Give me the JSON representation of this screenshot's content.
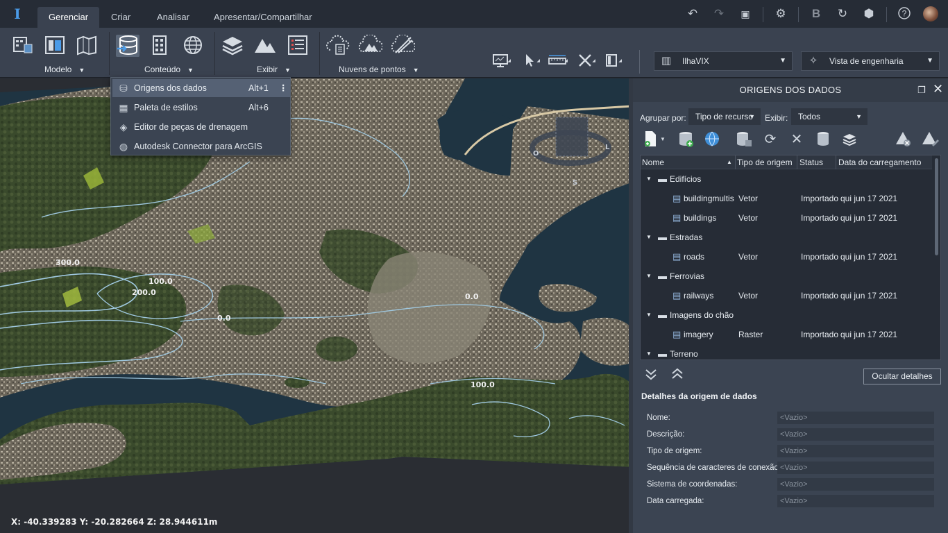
{
  "tabs": [
    {
      "label": "Gerenciar",
      "active": true
    },
    {
      "label": "Criar"
    },
    {
      "label": "Analisar"
    },
    {
      "label": "Apresentar/Compartilhar"
    }
  ],
  "top_icons": [
    "undo-icon",
    "redo-icon",
    "screen-icon",
    "gear-icon",
    "b-icon",
    "sync-icon",
    "cube-icon",
    "help-icon",
    "avatar"
  ],
  "ribbon": {
    "groups": [
      {
        "label": "Modelo"
      },
      {
        "label": "Conteúdo"
      },
      {
        "label": "Exibir"
      },
      {
        "label": "Nuvens de pontos"
      }
    ],
    "model_combo": "IlhaVIX",
    "view_combo": "Vista de engenharia"
  },
  "dropdown": {
    "items": [
      {
        "label": "Origens dos dados",
        "shortcut": "Alt+1",
        "more": "⋮",
        "icon": "database-icon"
      },
      {
        "label": "Paleta de estilos",
        "shortcut": "Alt+6",
        "icon": "palette-icon"
      },
      {
        "label": "Editor de peças de drenagem",
        "icon": "drainage-icon"
      },
      {
        "label": "Autodesk Connector para ArcGIS",
        "icon": "globe-icon"
      }
    ]
  },
  "viewport": {
    "contours": [
      "300.0",
      "100.0",
      "200.0",
      "0.0",
      "0.0",
      "100.0"
    ],
    "compass": {
      "w": "O",
      "e": "L",
      "s": "S"
    },
    "coords": "X: -40.339283 Y: -20.282664 Z: 28.944611m"
  },
  "panel": {
    "title": "ORIGENS DOS DADOS",
    "group_by_label": "Agrupar por:",
    "group_by_value": "Tipo de recurso",
    "show_label": "Exibir:",
    "show_value": "Todos",
    "columns": [
      "Nome",
      "Tipo de origem",
      "Status",
      "Data do carregamento"
    ],
    "rows": [
      {
        "kind": "folder",
        "name": "Edifícios"
      },
      {
        "kind": "file",
        "name": "buildingmultis",
        "type": "Vetor",
        "status": "Importado",
        "date": "qui jun 17 2021"
      },
      {
        "kind": "file",
        "name": "buildings",
        "type": "Vetor",
        "status": "Importado",
        "date": "qui jun 17 2021"
      },
      {
        "kind": "folder",
        "name": "Estradas"
      },
      {
        "kind": "file",
        "name": "roads",
        "type": "Vetor",
        "status": "Importado",
        "date": "qui jun 17 2021"
      },
      {
        "kind": "folder",
        "name": "Ferrovias"
      },
      {
        "kind": "file",
        "name": "railways",
        "type": "Vetor",
        "status": "Importado",
        "date": "qui jun 17 2021"
      },
      {
        "kind": "folder",
        "name": "Imagens do chão"
      },
      {
        "kind": "file",
        "name": "imagery",
        "type": "Raster",
        "status": "Importado",
        "date": "qui jun 17 2021"
      },
      {
        "kind": "folder",
        "name": "Terreno"
      }
    ],
    "hide_details": "Ocultar detalhes",
    "details_title": "Detalhes da origem de dados",
    "details": [
      {
        "label": "Nome:",
        "value": "<Vazio>"
      },
      {
        "label": "Descrição:",
        "value": "<Vazio>"
      },
      {
        "label": "Tipo de origem:",
        "value": "<Vazio>"
      },
      {
        "label": "Sequência de caracteres de conexão:",
        "value": "<Vazio>"
      },
      {
        "label": "Sistema de coordenadas:",
        "value": "<Vazio>"
      },
      {
        "label": "Data carregada:",
        "value": "<Vazio>"
      }
    ]
  },
  "colors": {
    "accent": "#4a9be8",
    "panel": "#3b4452",
    "ribbon": "#3a4250",
    "water": "#1f3442"
  }
}
